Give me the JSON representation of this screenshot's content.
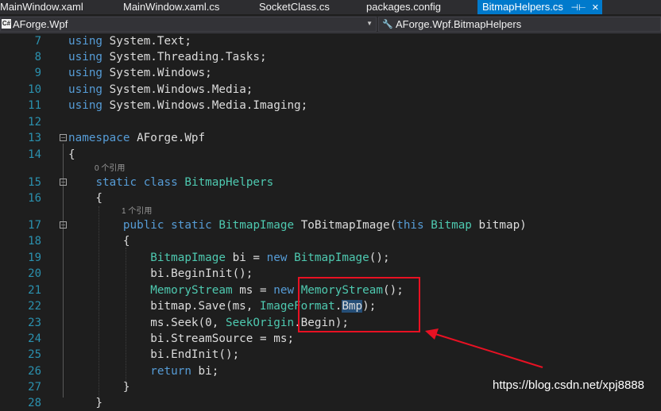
{
  "tabs": [
    {
      "label": "MainWindow.xaml",
      "active": false
    },
    {
      "label": "MainWindow.xaml.cs",
      "active": false
    },
    {
      "label": "SocketClass.cs",
      "active": false
    },
    {
      "label": "packages.config",
      "active": false
    },
    {
      "label": "BitmapHelpers.cs",
      "active": true
    }
  ],
  "tab_icons": {
    "pin": "⊣⊢",
    "close": "✕"
  },
  "nav": {
    "project_label": "AForge.Wpf",
    "project_icon": "C#",
    "class_label": "AForge.Wpf.BitmapHelpers"
  },
  "code_lines": [
    {
      "num": "7",
      "text": "using System.Text;"
    },
    {
      "num": "8",
      "text": "using System.Threading.Tasks;"
    },
    {
      "num": "9",
      "text": "using System.Windows;"
    },
    {
      "num": "10",
      "text": "using System.Windows.Media;"
    },
    {
      "num": "11",
      "text": "using System.Windows.Media.Imaging;"
    },
    {
      "num": "12",
      "text": ""
    },
    {
      "num": "13",
      "text": "namespace AForge.Wpf"
    },
    {
      "num": "14",
      "text": "{"
    },
    {
      "num": "15",
      "text": "static class BitmapHelpers"
    },
    {
      "num": "16",
      "text": "{"
    },
    {
      "num": "17",
      "text": "public static BitmapImage ToBitmapImage(this Bitmap bitmap)"
    },
    {
      "num": "18",
      "text": "{"
    },
    {
      "num": "19",
      "text": "BitmapImage bi = new BitmapImage();"
    },
    {
      "num": "20",
      "text": "bi.BeginInit();"
    },
    {
      "num": "21",
      "text": "MemoryStream ms = new MemoryStream();"
    },
    {
      "num": "22",
      "text": "bitmap.Save(ms, ImageFormat.Bmp);"
    },
    {
      "num": "23",
      "text": "ms.Seek(0, SeekOrigin.Begin);"
    },
    {
      "num": "24",
      "text": "bi.StreamSource = ms;"
    },
    {
      "num": "25",
      "text": "bi.EndInit();"
    },
    {
      "num": "26",
      "text": "return bi;"
    },
    {
      "num": "27",
      "text": "}"
    },
    {
      "num": "28",
      "text": "}"
    }
  ],
  "reference_hints": {
    "class": "0 个引用",
    "method": "1 个引用"
  },
  "watermark": "https://blog.csdn.net/xpj8888",
  "colors": {
    "keyword": "#569cd6",
    "type": "#4ec9b0",
    "identifier": "#dcdcdc",
    "line_number": "#2b91af",
    "selection": "#264f78",
    "annotation": "#e81123",
    "active_tab": "#007acc"
  }
}
